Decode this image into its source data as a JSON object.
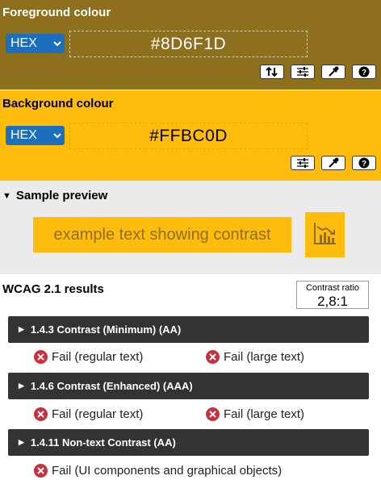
{
  "foreground": {
    "title": "Foreground colour",
    "format": "HEX",
    "value": "#8D6F1D",
    "color": "#8D6F1D",
    "tools": [
      "swap-icon",
      "sliders-icon",
      "eyedropper-icon",
      "help-icon"
    ]
  },
  "background": {
    "title": "Background colour",
    "format": "HEX",
    "value": "#FFBC0D",
    "color": "#FFBC0D",
    "tools": [
      "sliders-icon",
      "eyedropper-icon",
      "help-icon"
    ]
  },
  "preview": {
    "title": "Sample preview",
    "sample_text": "example text showing contrast"
  },
  "results": {
    "title": "WCAG 2.1 results",
    "contrast_label": "Contrast ratio",
    "contrast_value": "2,8:1",
    "criteria": [
      {
        "label": "1.4.3 Contrast (Minimum) (AA)",
        "results": [
          "Fail (regular text)",
          "Fail (large text)"
        ]
      },
      {
        "label": "1.4.6 Contrast (Enhanced) (AAA)",
        "results": [
          "Fail (regular text)",
          "Fail (large text)"
        ]
      },
      {
        "label": "1.4.11 Non-text Contrast (AA)",
        "results": [
          "Fail (UI components and graphical objects)"
        ]
      }
    ]
  },
  "colors": {
    "select_blue": "#1b6fbd",
    "fail_red": "#c9303e",
    "criteria_bar": "#333333",
    "preview_bg": "#ebebeb"
  }
}
